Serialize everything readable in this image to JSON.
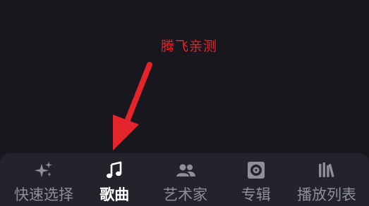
{
  "annotation": {
    "text": "腾飞亲测",
    "color": "#e3242b"
  },
  "tabbar": {
    "active_index": 1,
    "tabs": [
      {
        "label": "快速选择",
        "icon": "sparkles-icon"
      },
      {
        "label": "歌曲",
        "icon": "music-note-icon"
      },
      {
        "label": "艺术家",
        "icon": "people-icon"
      },
      {
        "label": "专辑",
        "icon": "album-disc-icon"
      },
      {
        "label": "播放列表",
        "icon": "library-icon"
      }
    ]
  },
  "colors": {
    "background": "#17171d",
    "tabbar_background": "#22232b",
    "tab_inactive": "#8f9097",
    "tab_active": "#ffffff",
    "annotation": "#e3242b"
  }
}
